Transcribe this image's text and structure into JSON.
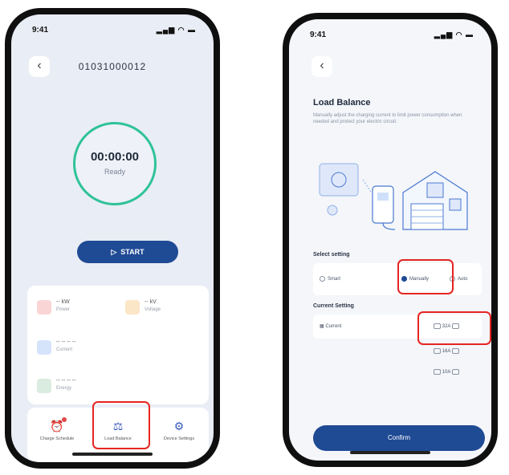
{
  "left_screen": {
    "status": {
      "time": "9:41",
      "icons": "▂▄▆ ◠ ▬"
    },
    "back_icon": "‹",
    "device_id": "01031000012",
    "timer": "00:00:00",
    "status_text": "Ready",
    "start_label": "START",
    "stats": [
      {
        "value": "-- kW",
        "label": "Power",
        "color": "#f9d5d5"
      },
      {
        "value": "-- kV",
        "label": "Voltage",
        "color": "#fbe6c8"
      },
      {
        "value": "-- -- -- --",
        "label": "Current",
        "color": "#d6e4fb"
      },
      {
        "value": "-- -- -- --",
        "label": "Energy",
        "color": "#d9ecdf"
      }
    ],
    "actions": [
      {
        "icon": "⏰",
        "label": "Charge Schedule"
      },
      {
        "icon": "⚖",
        "label": "Load Balance"
      },
      {
        "icon": "⚙",
        "label": "Device Settings"
      }
    ]
  },
  "right_screen": {
    "status": {
      "time": "9:41",
      "icons": "▂▄▆ ◠ ▬"
    },
    "back_icon": "‹",
    "title": "Load Balance",
    "description": "Manually adjust the charging current to limit power consumption when needed and protect your electric circuit.",
    "mode_label": "Select setting",
    "modes": [
      {
        "label": "Smart",
        "selected": false
      },
      {
        "label": "Manually",
        "selected": true
      },
      {
        "label": "Auto",
        "selected": false
      }
    ],
    "current_label": "Current Setting",
    "current_field": "Current",
    "current_options": [
      "32A",
      "16A",
      "10A"
    ],
    "confirm_label": "Confirm"
  },
  "colors": {
    "accent": "#1f4a94",
    "ring": "#2fc29a",
    "highlight": "#e52521"
  }
}
